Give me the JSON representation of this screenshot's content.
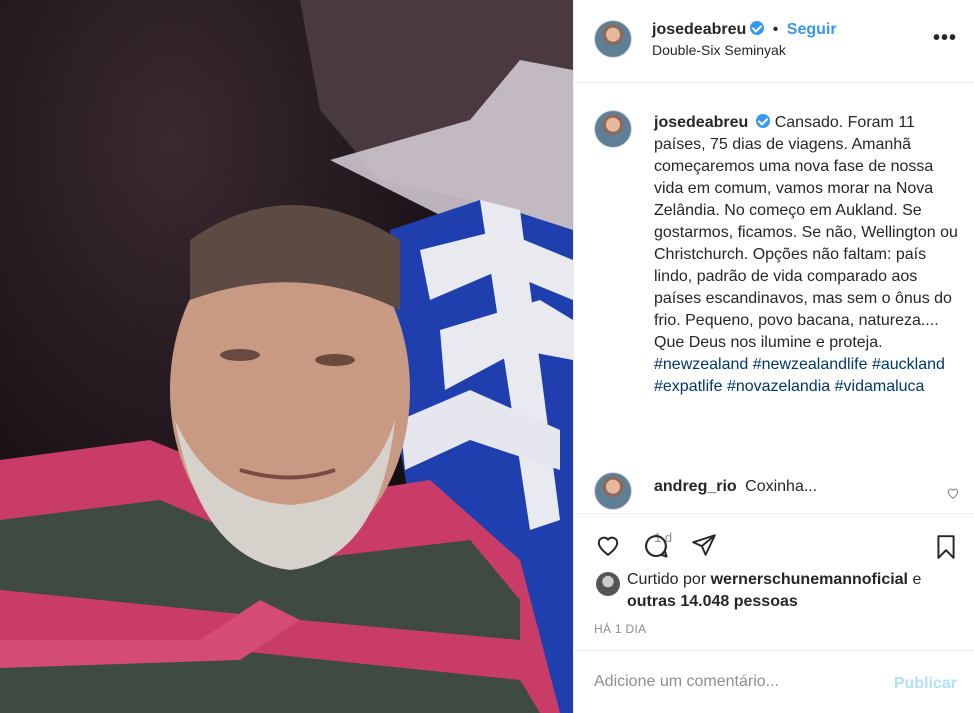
{
  "post": {
    "author": "josedeabreu",
    "follow_label": "Seguir",
    "separator": "•",
    "location": "Double-Six Seminyak",
    "more_label": "•••"
  },
  "caption": {
    "author": "josedeabreu",
    "text": "Cansado. Foram 11 países, 75 dias de viagens. Amanhã começaremos uma nova fase de nossa vida em comum, vamos morar na Nova Zelândia. No começo em Aukland. Se gostarmos, ficamos. Se não, Wellington ou Christchurch. Opções não faltam: país lindo, padrão de vida comparado aos países escandinavos, mas sem o ônus do frio. Pequeno, povo bacana, natureza.... Que Deus nos ilumine e proteja.",
    "hashtags": [
      "#newzealand",
      "#newzealandlife",
      "#auckland",
      "#expatlife",
      "#novazelandia",
      "#vidamaluca"
    ],
    "time_ago": "1 d"
  },
  "comments": [
    {
      "author": "andreg_rio",
      "text": "Coxinha..."
    }
  ],
  "likes": {
    "prefix": "Curtido por",
    "user": "wernerschunemannoficial",
    "conjunction": "e",
    "others": "outras 14.048 pessoas"
  },
  "date_label": "HÁ 1 DIA",
  "add_comment": {
    "placeholder": "Adicione um comentário...",
    "publish_label": "Publicar"
  },
  "icons": {
    "like": "heart-icon",
    "comment": "comment-icon",
    "share": "paper-plane-icon",
    "save": "bookmark-icon",
    "comment_like": "small-heart-icon"
  },
  "colors": {
    "link_blue": "#3897f0",
    "hashtag": "#00376b",
    "muted": "#8e8e8e",
    "publish_disabled": "#b2dffc"
  }
}
